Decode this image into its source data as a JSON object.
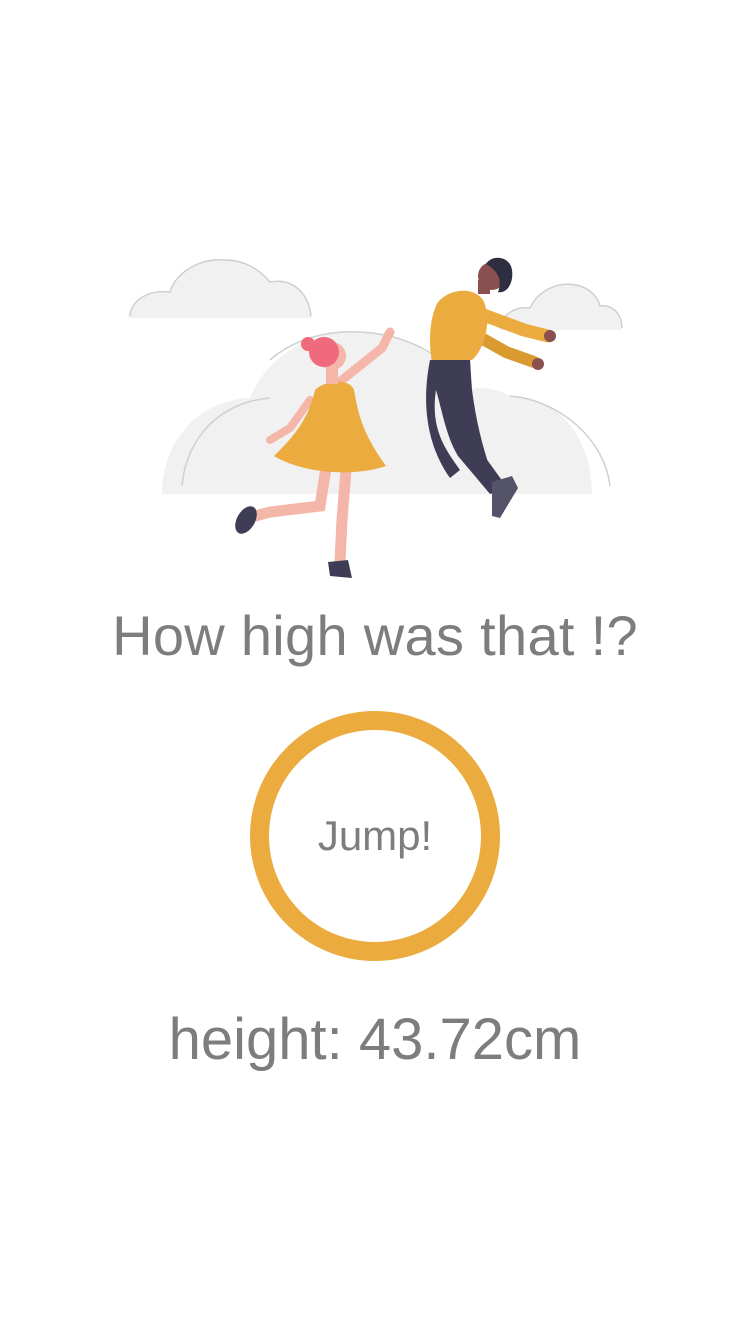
{
  "app": {
    "accent_color": "#EBAB3F",
    "text_color": "#7d7d7d"
  },
  "illustration": {
    "icon": "jumping-people-illustration"
  },
  "headline": {
    "text": "How high was that !?"
  },
  "jump_button": {
    "label": "Jump!"
  },
  "result": {
    "prefix": "height:",
    "value": "43.72",
    "unit": "cm",
    "text": "height: 43.72cm"
  }
}
